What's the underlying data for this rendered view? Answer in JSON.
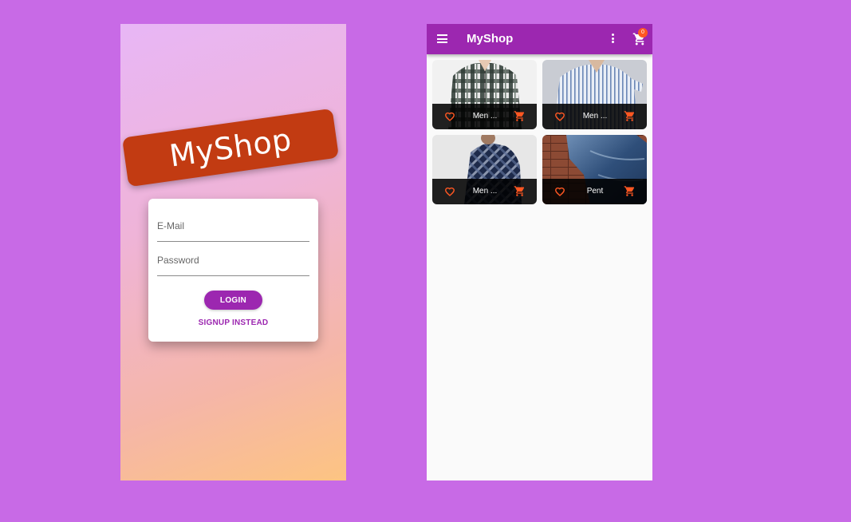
{
  "login": {
    "brand": "MyShop",
    "email_placeholder": "E-Mail",
    "password_placeholder": "Password",
    "login_label": "LOGIN",
    "signup_label": "SIGNUP INSTEAD"
  },
  "shop": {
    "title": "MyShop",
    "cart_count": "0",
    "products": [
      {
        "title": "Men ...",
        "image": "plaid-shirt"
      },
      {
        "title": "Men ...",
        "image": "striped-shirt"
      },
      {
        "title": "Men ...",
        "image": "navy-check-shirt"
      },
      {
        "title": "Pent",
        "image": "denim-jeans"
      }
    ]
  },
  "icons": {
    "menu": "menu-icon",
    "more": "more-vert-icon",
    "cart": "shopping-cart-icon",
    "favorite": "heart-outline-icon"
  },
  "colors": {
    "primary": "#9c27b0",
    "accent": "#ff5722",
    "brand_banner": "#c23b12",
    "page_background": "#c86ae6"
  }
}
